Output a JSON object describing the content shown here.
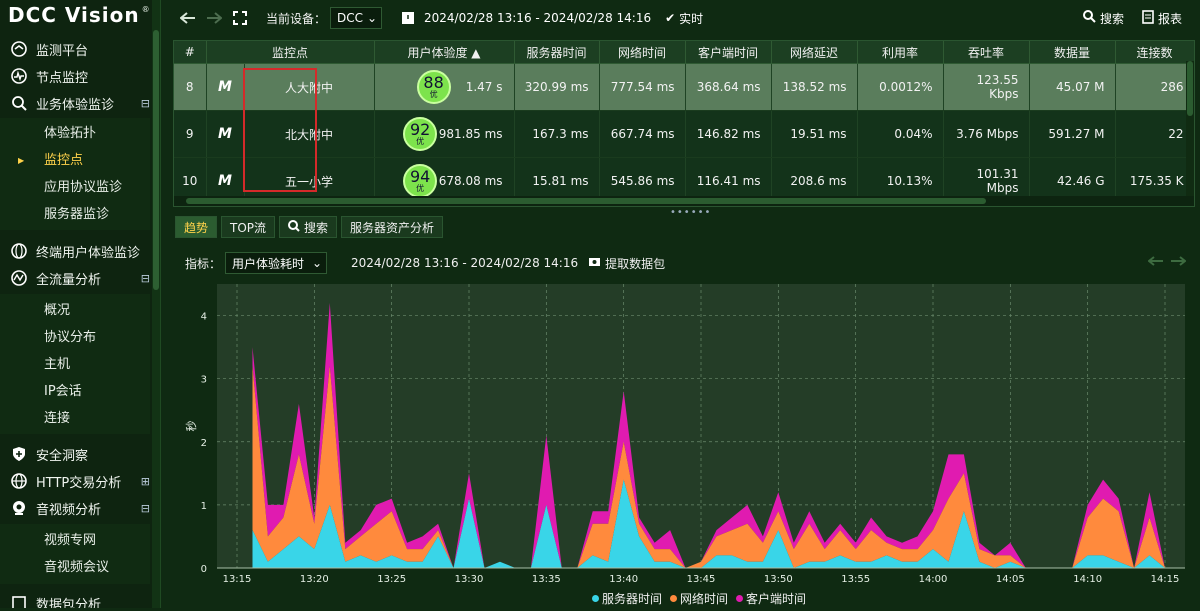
{
  "app": {
    "logo_text": "DCC Vision"
  },
  "sidebar": {
    "items": [
      {
        "label": "监测平台",
        "icon": "dashboard-icon"
      },
      {
        "label": "节点监控",
        "icon": "pulse-icon"
      },
      {
        "label": "业务体验监诊",
        "icon": "search-chart-icon",
        "expand": "⊟",
        "children": [
          "体验拓扑",
          "监控点",
          "应用协议监诊",
          "服务器监诊"
        ],
        "active_child": "监控点"
      },
      {
        "label": "终端用户体验监诊",
        "icon": "globe-icon"
      },
      {
        "label": "全流量分析",
        "icon": "wave-icon",
        "expand": "⊟",
        "children": [
          "概况",
          "协议分布",
          "主机",
          "IP会话",
          "连接"
        ]
      },
      {
        "label": "安全洞察",
        "icon": "shield-icon"
      },
      {
        "label": "HTTP交易分析",
        "icon": "globe-icon",
        "expand": "⊞"
      },
      {
        "label": "音视频分析",
        "icon": "camera-icon",
        "expand": "⊟",
        "children": [
          "视频专网",
          "音视频会议"
        ]
      },
      {
        "label": "数据包分析",
        "icon": "packet-icon"
      }
    ]
  },
  "toolbar": {
    "current_device_label": "当前设备：",
    "device_value": "DCC",
    "time_range": "2024/02/28 13:16 - 2024/02/28 14:16",
    "realtime_label": "实时",
    "search_label": "搜索",
    "report_label": "报表"
  },
  "table": {
    "columns": [
      "#",
      "监控点",
      "用户体验度 ▲",
      "服务器时间",
      "网络时间",
      "客户端时间",
      "网络延迟",
      "利用率",
      "吞吐率",
      "数据量",
      "连接数"
    ],
    "rows": [
      {
        "idx": "8",
        "name": "人大附中",
        "score": "88",
        "grade": "优",
        "ux": "1.47 s",
        "server": "320.99 ms",
        "net": "777.54 ms",
        "client": "368.64 ms",
        "delay": "138.52 ms",
        "util": "0.0012%",
        "thru": "123.55 Kbps",
        "volume": "45.07 M",
        "conns": "286"
      },
      {
        "idx": "9",
        "name": "北大附中",
        "score": "92",
        "grade": "优",
        "ux": "981.85 ms",
        "server": "167.3 ms",
        "net": "667.74 ms",
        "client": "146.82 ms",
        "delay": "19.51 ms",
        "util": "0.04%",
        "thru": "3.76 Mbps",
        "volume": "591.27 M",
        "conns": "22"
      },
      {
        "idx": "10",
        "name": "五一小学",
        "score": "94",
        "grade": "优",
        "ux": "678.08 ms",
        "server": "15.81 ms",
        "net": "545.86 ms",
        "client": "116.41 ms",
        "delay": "208.6 ms",
        "util": "10.13%",
        "thru": "101.31 Mbps",
        "volume": "42.46 G",
        "conns": "175.35 K"
      }
    ]
  },
  "tabs": [
    "趋势",
    "TOP流",
    "搜索",
    "服务器资产分析"
  ],
  "filter": {
    "metric_label": "指标：",
    "metric_value": "用户体验耗时",
    "time_range": "2024/02/28 13:16 - 2024/02/28 14:16",
    "extract_label": "提取数据包"
  },
  "chart_data": {
    "type": "area",
    "stacked": true,
    "ylabel": "秒",
    "ylim": [
      0,
      4.5
    ],
    "yticks": [
      0,
      1,
      2,
      3,
      4
    ],
    "xticks": [
      "13:15",
      "13:20",
      "13:25",
      "13:30",
      "13:35",
      "13:40",
      "13:45",
      "13:50",
      "13:55",
      "14:00",
      "14:05",
      "14:10",
      "14:15"
    ],
    "x": [
      "13:16",
      "13:17",
      "13:18",
      "13:19",
      "13:20",
      "13:21",
      "13:22",
      "13:23",
      "13:24",
      "13:25",
      "13:26",
      "13:27",
      "13:28",
      "13:29",
      "13:30",
      "13:31",
      "13:32",
      "13:33",
      "13:34",
      "13:35",
      "13:36",
      "13:37",
      "13:38",
      "13:39",
      "13:40",
      "13:41",
      "13:42",
      "13:43",
      "13:44",
      "13:45",
      "13:46",
      "13:47",
      "13:48",
      "13:49",
      "13:50",
      "13:51",
      "13:52",
      "13:53",
      "13:54",
      "13:55",
      "13:56",
      "13:57",
      "13:58",
      "13:59",
      "14:00",
      "14:01",
      "14:02",
      "14:03",
      "14:04",
      "14:05",
      "14:06",
      "14:07",
      "14:08",
      "14:09",
      "14:10",
      "14:11",
      "14:12",
      "14:13",
      "14:14",
      "14:15"
    ],
    "series": [
      {
        "name": "服务器时间",
        "color": "#39d5e8",
        "values": [
          0.6,
          0.1,
          0.3,
          0.5,
          0.3,
          1.0,
          0.1,
          0.2,
          0.1,
          0.2,
          0.1,
          0.1,
          0.5,
          0.0,
          1.1,
          0.0,
          0.1,
          0.0,
          0.0,
          1.0,
          0.0,
          0.0,
          0.2,
          0.1,
          1.4,
          0.5,
          0.1,
          0.1,
          0.0,
          0.0,
          0.2,
          0.2,
          0.1,
          0.1,
          0.6,
          0.0,
          0.1,
          0.1,
          0.2,
          0.1,
          0.1,
          0.2,
          0.1,
          0.1,
          0.3,
          0.1,
          0.9,
          0.1,
          0.0,
          0.1,
          0.0,
          0.0,
          0.0,
          0.0,
          0.2,
          0.2,
          0.1,
          0.0,
          0.2,
          0.0
        ]
      },
      {
        "name": "网络时间",
        "color": "#ff8a3d",
        "values": [
          2.6,
          0.4,
          0.5,
          1.3,
          0.4,
          2.2,
          0.2,
          0.3,
          0.6,
          0.7,
          0.2,
          0.2,
          0.1,
          0.0,
          0.0,
          0.0,
          0.0,
          0.0,
          0.0,
          0.0,
          0.0,
          0.0,
          0.5,
          0.6,
          0.6,
          0.2,
          0.2,
          0.2,
          0.0,
          0.1,
          0.3,
          0.4,
          0.6,
          0.3,
          0.3,
          0.3,
          0.6,
          0.2,
          0.4,
          0.2,
          0.5,
          0.2,
          0.2,
          0.2,
          0.3,
          1.0,
          0.6,
          0.2,
          0.2,
          0.1,
          0.0,
          0.0,
          0.0,
          0.0,
          0.6,
          0.9,
          0.8,
          0.0,
          0.6,
          0.0
        ]
      },
      {
        "name": "客户端时间",
        "color": "#e01bb0",
        "values": [
          0.3,
          0.5,
          0.2,
          0.8,
          0.1,
          1.0,
          0.1,
          0.1,
          0.3,
          0.2,
          0.1,
          0.2,
          0.1,
          0.0,
          0.4,
          0.0,
          0.0,
          0.0,
          0.0,
          1.1,
          0.0,
          0.0,
          0.2,
          0.2,
          0.8,
          0.1,
          0.1,
          0.3,
          0.0,
          0.0,
          0.1,
          0.2,
          0.3,
          0.1,
          0.3,
          0.1,
          0.2,
          0.1,
          0.1,
          0.1,
          0.2,
          0.1,
          0.1,
          0.2,
          0.3,
          0.7,
          0.3,
          0.1,
          0.0,
          0.2,
          0.0,
          0.0,
          0.0,
          0.0,
          0.2,
          0.3,
          0.2,
          0.0,
          0.4,
          0.0
        ]
      }
    ],
    "legend_position": "bottom-center",
    "grid": true
  }
}
